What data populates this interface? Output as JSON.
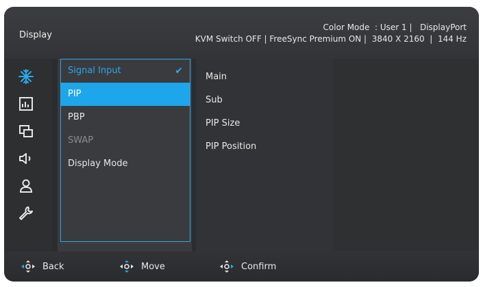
{
  "header": {
    "title": "Display",
    "status_line1": "Color Mode  : User 1 |   DisplayPort",
    "status_line2": "KVM Switch OFF | FreeSync Premium ON |  3840 X 2160  |  144 Hz"
  },
  "sidebar": {
    "icons": [
      {
        "name": "display-icon"
      },
      {
        "name": "picture-icon"
      },
      {
        "name": "pip-icon"
      },
      {
        "name": "audio-icon"
      },
      {
        "name": "user-icon"
      },
      {
        "name": "system-icon"
      }
    ]
  },
  "menu": {
    "items": [
      {
        "label": "Signal Input"
      },
      {
        "label": "PIP"
      },
      {
        "label": "PBP"
      },
      {
        "label": "SWAP"
      },
      {
        "label": "Display Mode"
      }
    ]
  },
  "submenu": {
    "items": [
      {
        "label": "Main"
      },
      {
        "label": "Sub"
      },
      {
        "label": "PIP Size"
      },
      {
        "label": "PIP Position"
      }
    ]
  },
  "footer": {
    "back": "Back",
    "move": "Move",
    "confirm": "Confirm"
  },
  "colors": {
    "accent": "#1da6ea",
    "background": "#2b2c2e"
  }
}
